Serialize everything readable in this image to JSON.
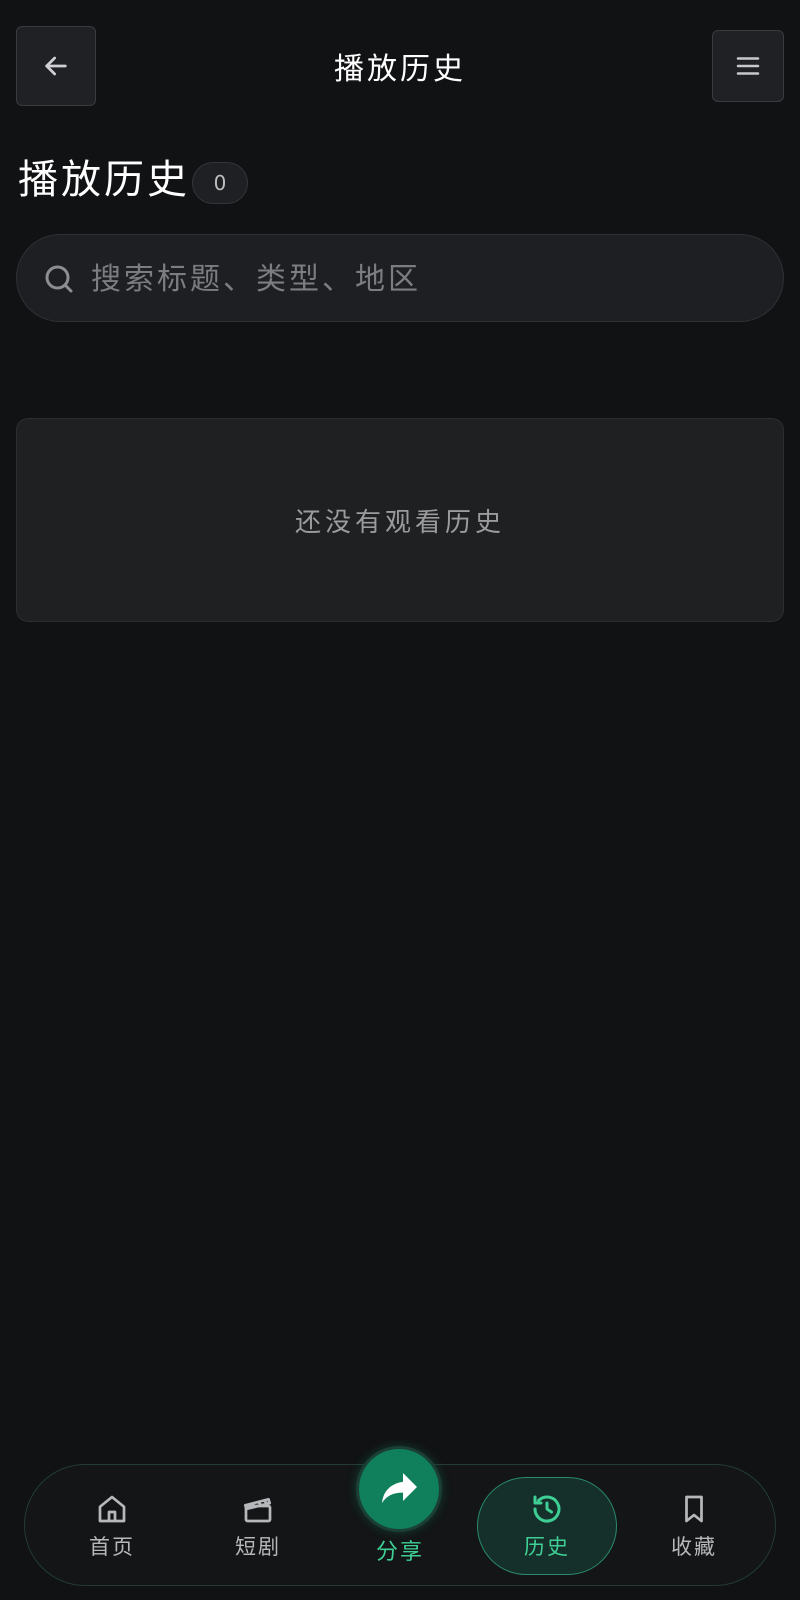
{
  "header": {
    "title": "播放历史",
    "back_icon": "arrow-left-icon",
    "menu_icon": "hamburger-menu-icon"
  },
  "section": {
    "heading": "播放历史",
    "count": "0"
  },
  "search": {
    "placeholder": "搜索标题、类型、地区",
    "value": ""
  },
  "empty_state": {
    "message": "还没有观看历史"
  },
  "bottom_nav": {
    "items": [
      {
        "label": "首页",
        "icon": "home-icon"
      },
      {
        "label": "短剧",
        "icon": "clapperboard-icon"
      },
      {
        "label": "分享",
        "icon": "share-icon"
      },
      {
        "label": "历史",
        "icon": "history-icon",
        "active": true
      },
      {
        "label": "收藏",
        "icon": "bookmark-icon"
      }
    ]
  },
  "colors": {
    "background": "#111214",
    "accent": "#3ecf95",
    "share_button": "#10805c"
  }
}
